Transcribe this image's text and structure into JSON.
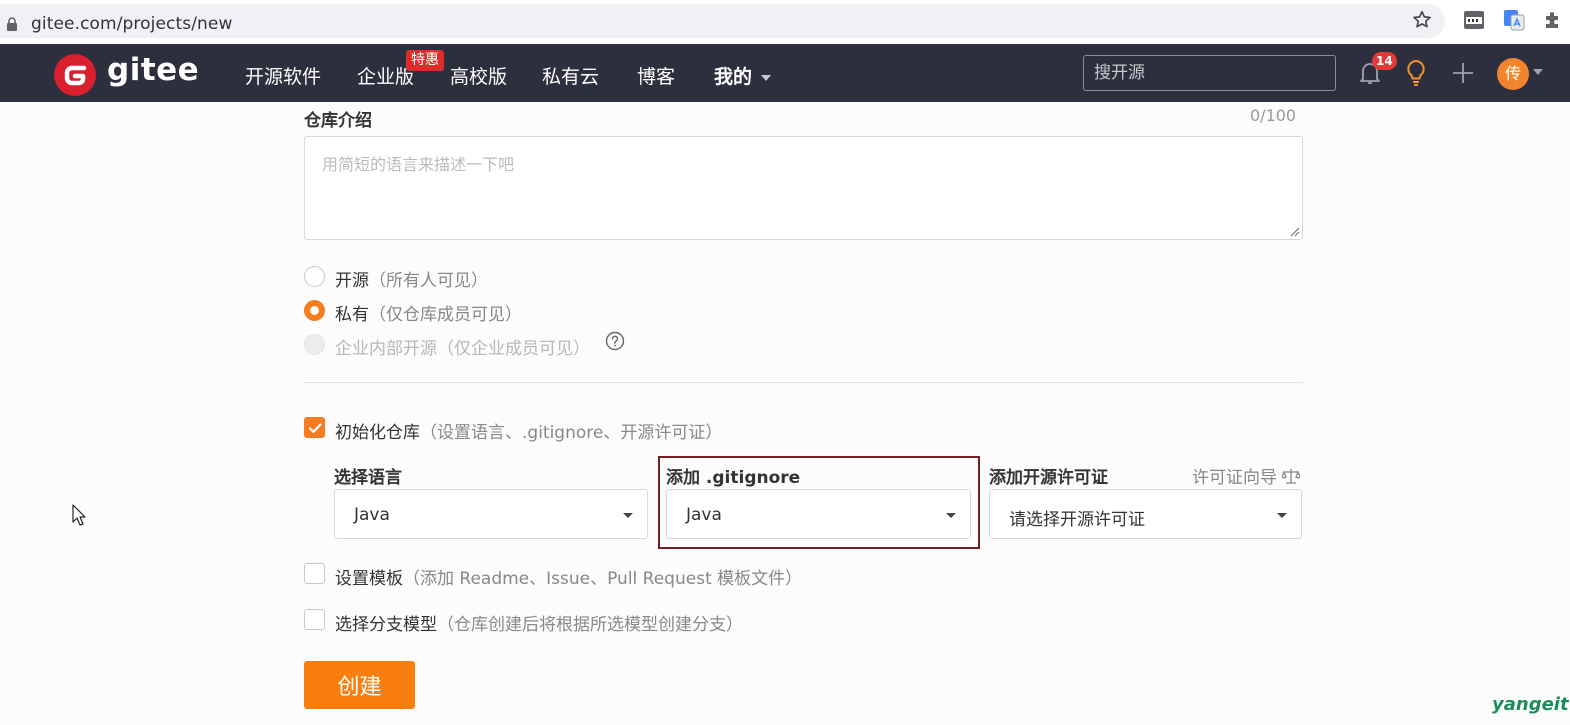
{
  "browser": {
    "url": "gitee.com/projects/new"
  },
  "navbar": {
    "logo_text": "gitee",
    "logo_letter": "G",
    "items": [
      {
        "label": "开源软件"
      },
      {
        "label": "企业版",
        "badge": "特惠"
      },
      {
        "label": "高校版"
      },
      {
        "label": "私有云"
      },
      {
        "label": "博客"
      },
      {
        "label": "我的"
      }
    ],
    "search_placeholder": "搜开源",
    "notification_count": "14",
    "avatar_text": "传"
  },
  "form": {
    "description": {
      "label": "仓库介绍",
      "counter": "0/100",
      "placeholder": "用简短的语言来描述一下吧"
    },
    "visibility": {
      "options": [
        {
          "label": "开源",
          "hint": "（所有人可见）",
          "selected": false,
          "disabled": false
        },
        {
          "label": "私有",
          "hint": "（仅仓库成员可见）",
          "selected": true,
          "disabled": false
        },
        {
          "label": "企业内部开源",
          "hint": "（仅企业成员可见）",
          "selected": false,
          "disabled": true
        }
      ]
    },
    "init_repo": {
      "label": "初始化仓库",
      "hint": "（设置语言、.gitignore、开源许可证）",
      "checked": true
    },
    "language": {
      "label": "选择语言",
      "value": "Java"
    },
    "gitignore": {
      "label": "添加 .gitignore",
      "value": "Java"
    },
    "license": {
      "label": "添加开源许可证",
      "wizard_label": "许可证向导",
      "value": "请选择开源许可证"
    },
    "template": {
      "label": "设置模板",
      "hint": "（添加 Readme、Issue、Pull Request 模板文件）",
      "checked": false
    },
    "branch_model": {
      "label": "选择分支模型",
      "hint": "（仓库创建后将根据所选模型创建分支）",
      "checked": false
    },
    "create_label": "创建"
  },
  "watermark": "yangeit",
  "colors": {
    "accent": "#fa7e0f",
    "navbar_bg": "#2d2f3e",
    "logo_red": "#d9202e",
    "badge_red": "#dd2d2a"
  }
}
